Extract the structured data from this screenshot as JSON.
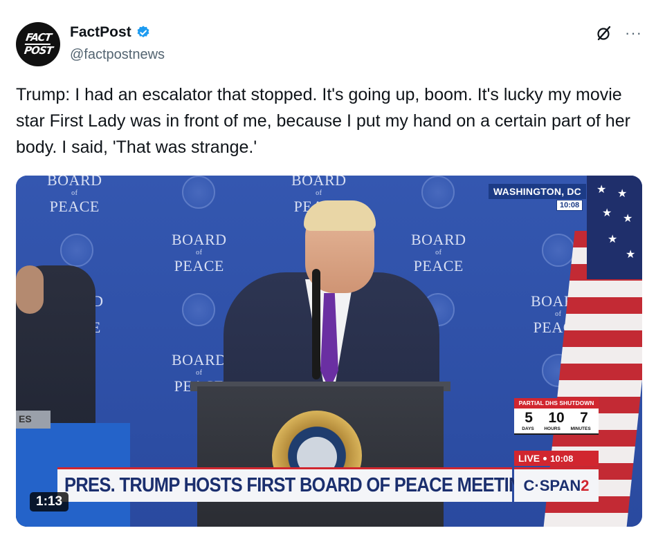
{
  "author": {
    "display_name": "FactPost",
    "handle": "@factpostnews",
    "avatar_text": [
      "FACT",
      "POST"
    ],
    "verified": true,
    "verified_color": "#1d9bf0"
  },
  "actions": {
    "grok_icon": "grok-icon",
    "more_label": "···"
  },
  "tweet": {
    "text": "Trump: I had an escalator that stopped. It's going up, boom. It's lucky my movie star First Lady was in front of me, because I put my hand on a certain part of her body. I said, 'That was strange.'"
  },
  "video": {
    "duration": "1:13",
    "backdrop_logo": {
      "line1": "BOARD",
      "line2": "of",
      "line3": "PEACE"
    },
    "dateline": "WASHINGTON, DC",
    "dateline_time": "10:08",
    "shutdown": {
      "title": "PARTIAL DHS SHUTDOWN",
      "values": [
        "5",
        "10",
        "7"
      ],
      "units": [
        "DAYS",
        "HOURS",
        "MINUTES"
      ]
    },
    "live": {
      "label": "LIVE",
      "time": "10:08"
    },
    "chyron": "PRES. TRUMP HOSTS FIRST BOARD OF PEACE MEETING",
    "network": {
      "prefix": "C·SPAN",
      "suffix": "2"
    },
    "table_plate": "ES",
    "colors": {
      "backdrop": "#2f4fa8",
      "chyron_text": "#1b2f6e",
      "network_red": "#d1262f"
    }
  }
}
